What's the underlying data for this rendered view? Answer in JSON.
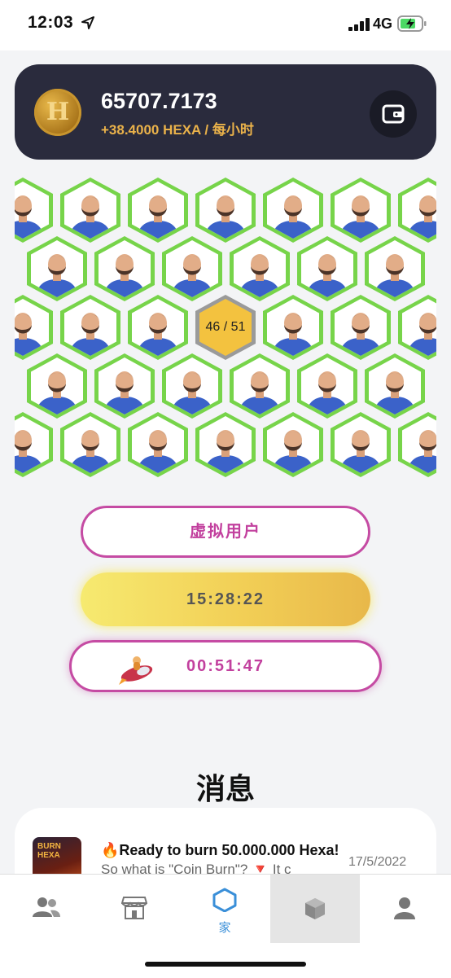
{
  "status_bar": {
    "time": "12:03",
    "network": "4G"
  },
  "wallet": {
    "coin_letter": "H",
    "balance": "65707.7173",
    "rate_amount": "+38.4000 HEXA",
    "rate_unit": " / 每小时"
  },
  "hex_grid": {
    "center_count": "46 / 51"
  },
  "buttons": {
    "virtual_user": "虚拟用户",
    "mining_timer": "15:28:22",
    "rocket_timer": "00:51:47"
  },
  "news": {
    "title": "消息",
    "items": [
      {
        "thumb_text": "BURN HEXA",
        "headline": "🔥Ready to burn 50.000.000 Hexa!",
        "snippet": "So what is \"Coin Burn\"? 🔻 It c",
        "date": "17/5/2022"
      }
    ]
  },
  "bottom_nav": {
    "items": [
      {
        "icon": "users-icon",
        "label": ""
      },
      {
        "icon": "shop-icon",
        "label": ""
      },
      {
        "icon": "hexagon-icon",
        "label": "家"
      },
      {
        "icon": "cube-icon",
        "label": ""
      },
      {
        "icon": "profile-icon",
        "label": ""
      }
    ],
    "active_color": "#3a8fd8"
  },
  "colors": {
    "wallet_bg": "#2a2b3d",
    "accent_gold": "#eab24a",
    "hex_border": "#77d44a",
    "button_magenta": "#c54ba3"
  }
}
